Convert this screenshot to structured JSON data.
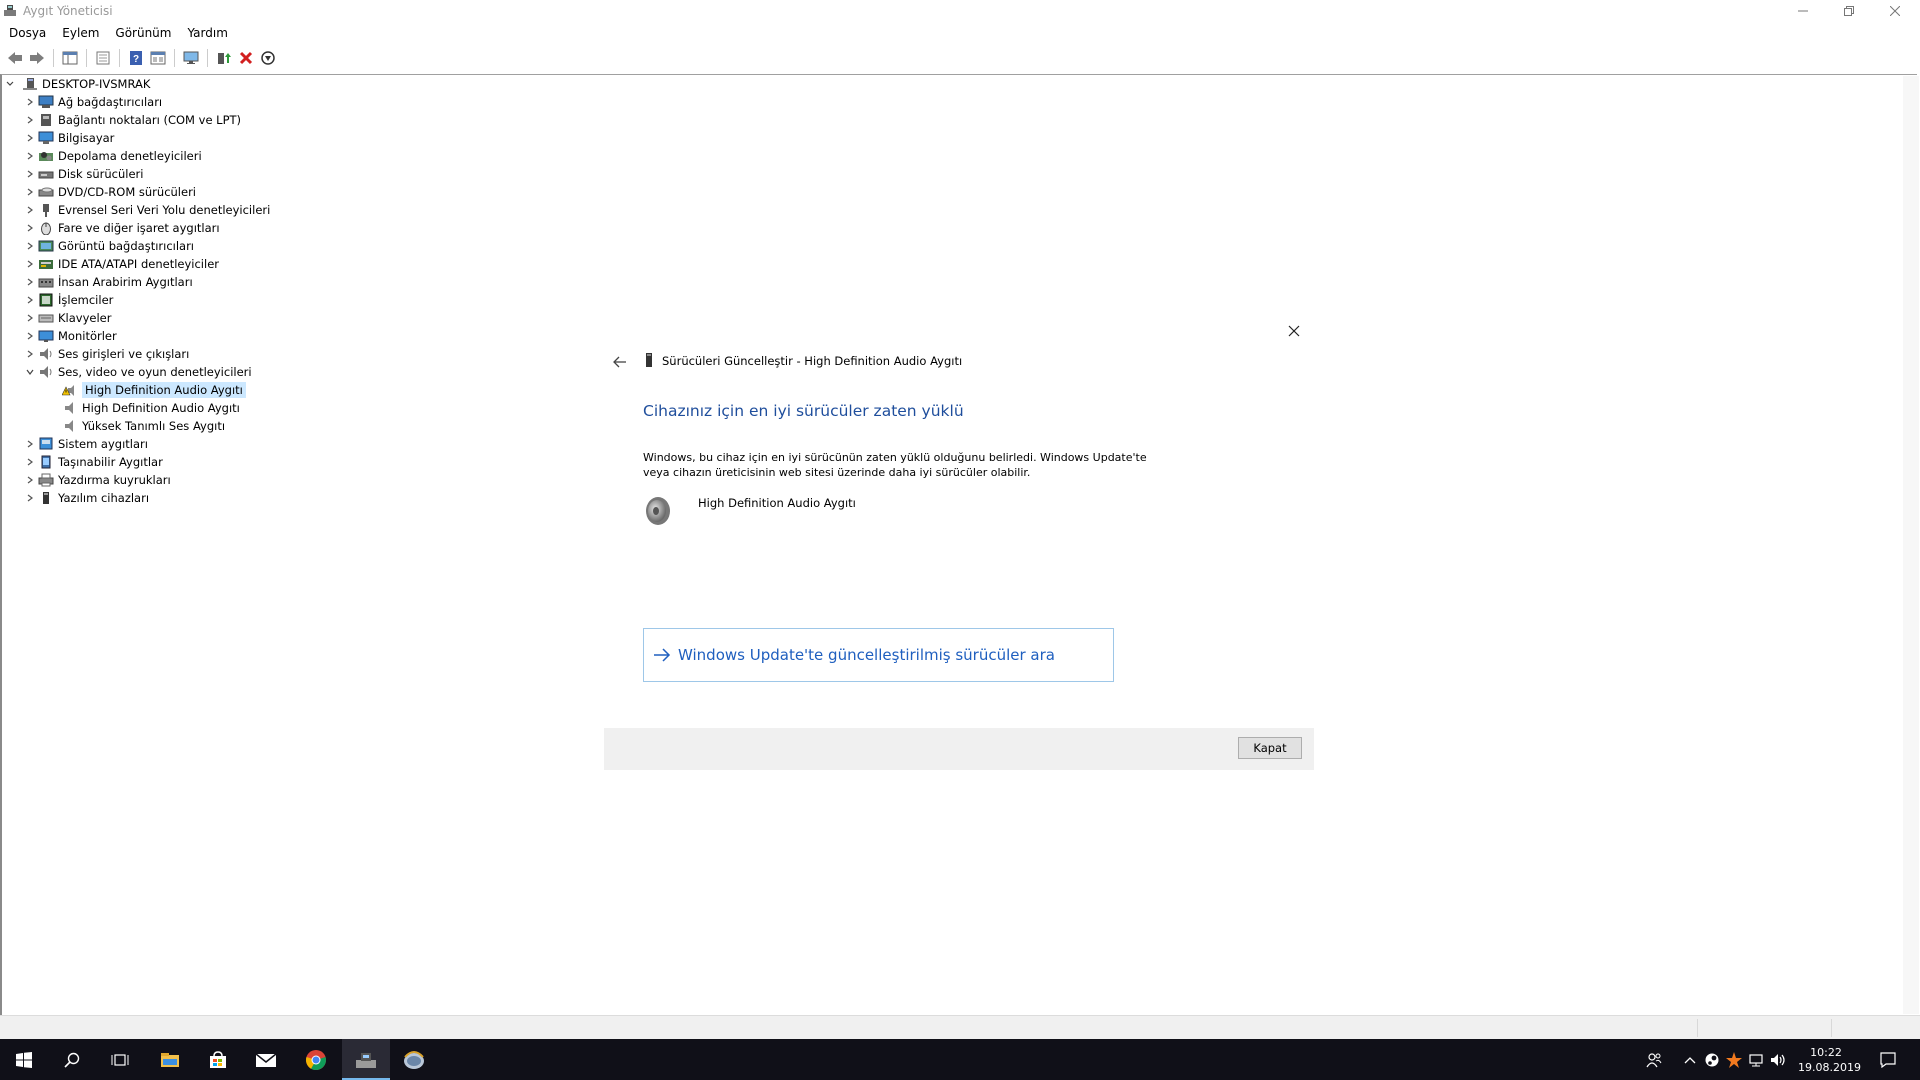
{
  "window": {
    "title": "Aygıt Yöneticisi",
    "controls": [
      "minimize",
      "restore",
      "close"
    ]
  },
  "menu": {
    "items": [
      "Dosya",
      "Eylem",
      "Görünüm",
      "Yardım"
    ]
  },
  "toolbar": {
    "buttons": [
      "back-icon",
      "forward-icon",
      "show-hide-console-tree-icon",
      "properties-icon",
      "help-icon",
      "view-icon",
      "monitor-icon",
      "update-driver-icon",
      "uninstall-icon",
      "scan-hardware-icon"
    ]
  },
  "tree": {
    "root": "DESKTOP-IVSMRAK",
    "categories": [
      {
        "label": "Ağ bağdaştırıcıları",
        "icon": "network-adapter-icon"
      },
      {
        "label": "Bağlantı noktaları (COM ve LPT)",
        "icon": "port-icon"
      },
      {
        "label": "Bilgisayar",
        "icon": "computer-icon"
      },
      {
        "label": "Depolama denetleyicileri",
        "icon": "storage-controller-icon"
      },
      {
        "label": "Disk sürücüleri",
        "icon": "disk-drive-icon"
      },
      {
        "label": "DVD/CD-ROM sürücüleri",
        "icon": "dvd-drive-icon"
      },
      {
        "label": "Evrensel Seri Veri Yolu denetleyicileri",
        "icon": "usb-icon"
      },
      {
        "label": "Fare ve diğer işaret aygıtları",
        "icon": "mouse-icon"
      },
      {
        "label": "Görüntü bağdaştırıcıları",
        "icon": "display-adapter-icon"
      },
      {
        "label": "IDE ATA/ATAPI denetleyiciler",
        "icon": "ide-controller-icon"
      },
      {
        "label": "İnsan Arabirim Aygıtları",
        "icon": "hid-icon"
      },
      {
        "label": "İşlemciler",
        "icon": "processor-icon"
      },
      {
        "label": "Klavyeler",
        "icon": "keyboard-icon"
      },
      {
        "label": "Monitörler",
        "icon": "monitor-icon"
      },
      {
        "label": "Ses girişleri ve çıkışları",
        "icon": "audio-io-icon"
      },
      {
        "label": "Ses, video ve oyun denetleyicileri",
        "icon": "sound-controller-icon",
        "expanded": true,
        "children": [
          {
            "label": "High Definition Audio Aygıtı",
            "icon": "warning-speaker-icon",
            "selected": true
          },
          {
            "label": "High Definition Audio Aygıtı",
            "icon": "speaker-icon"
          },
          {
            "label": "Yüksek Tanımlı Ses Aygıtı",
            "icon": "speaker-icon"
          }
        ]
      },
      {
        "label": "Sistem aygıtları",
        "icon": "system-device-icon"
      },
      {
        "label": "Taşınabilir Aygıtlar",
        "icon": "portable-device-icon"
      },
      {
        "label": "Yazdırma kuyrukları",
        "icon": "printer-icon"
      },
      {
        "label": "Yazılım cihazları",
        "icon": "software-device-icon"
      }
    ]
  },
  "dialog": {
    "title": "Sürücüleri Güncelleştir - High Definition Audio Aygıtı",
    "headline": "Cihazınız için en iyi sürücüler zaten yüklü",
    "description": "Windows, bu cihaz için en iyi sürücünün zaten yüklü olduğunu belirledi. Windows Update'te veya cihazın üreticisinin web sitesi üzerinde daha iyi sürücüler olabilir.",
    "device_name": "High Definition Audio Aygıtı",
    "link_label": "Windows Update'te güncelleştirilmiş sürücüler ara",
    "close_label": "Kapat"
  },
  "taskbar": {
    "apps": [
      "windows-start-icon",
      "search-icon",
      "task-view-icon",
      "file-explorer-icon",
      "store-icon",
      "mail-icon",
      "chrome-icon",
      "device-manager-icon",
      "update-wizard-icon"
    ],
    "active": "device-manager-icon",
    "tray": [
      "people-icon",
      "chevron-up-icon",
      "steam-icon",
      "avast-icon",
      "network-icon",
      "volume-icon"
    ],
    "time": "10:22",
    "date": "19.08.2019"
  },
  "colors": {
    "headline": "#1f4e9c",
    "link": "#1f5fbf",
    "selection": "#cce8ff",
    "taskbar": "#101018"
  }
}
